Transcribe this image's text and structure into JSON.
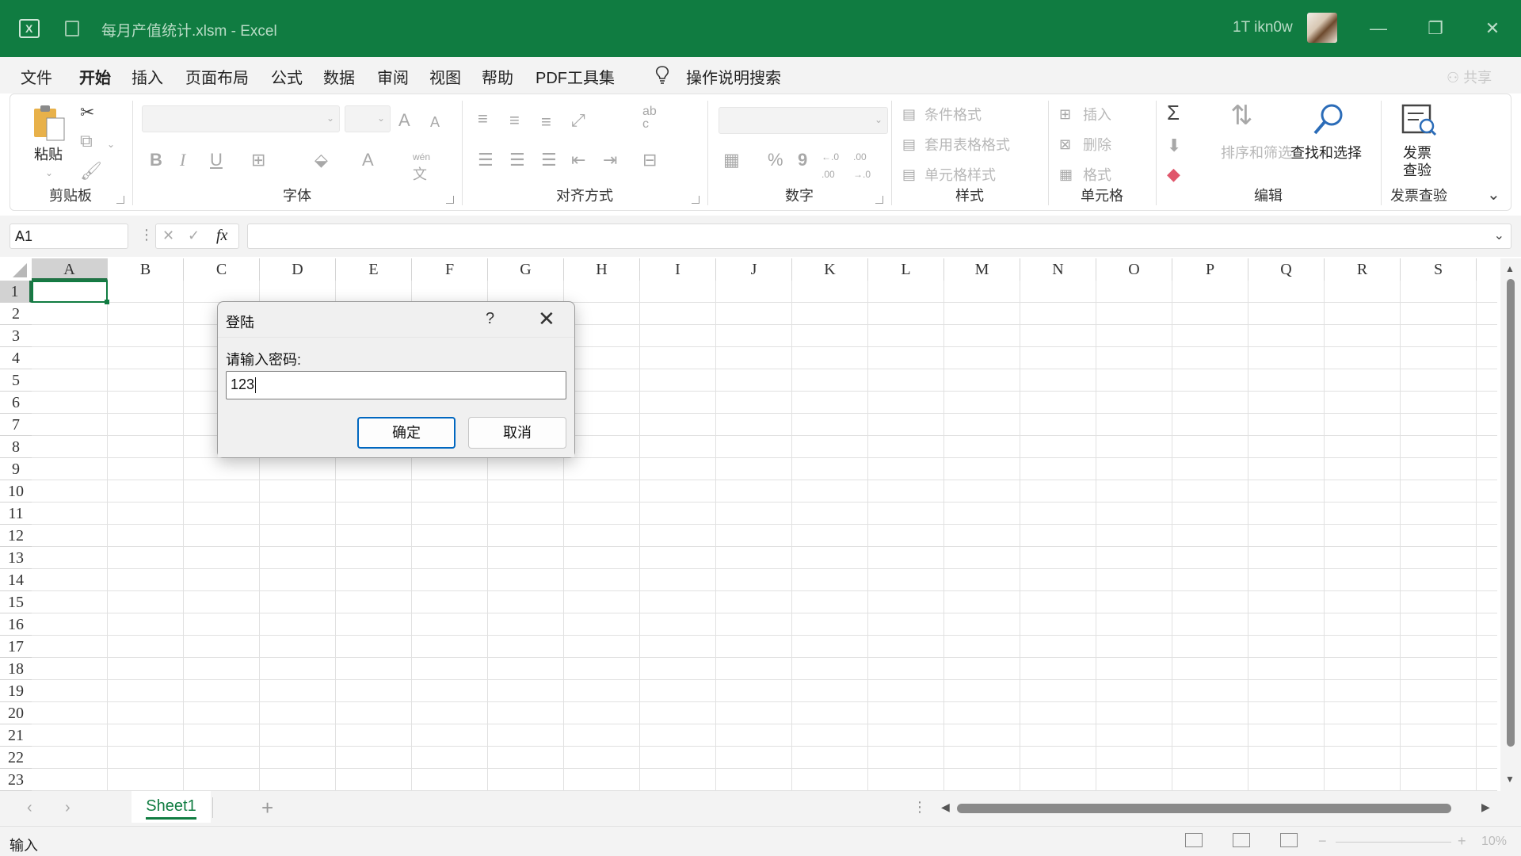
{
  "window": {
    "title": "每月产值统计.xlsm  -  Excel",
    "user": "1T ikn0w",
    "controls": {
      "minimize": "—",
      "restore": "❐",
      "close": "✕"
    }
  },
  "menu": {
    "tabs": [
      "文件",
      "开始",
      "插入",
      "页面布局",
      "公式",
      "数据",
      "审阅",
      "视图",
      "帮助",
      "PDF工具集"
    ],
    "active": "开始",
    "search": "操作说明搜索",
    "share": "共享"
  },
  "ribbon": {
    "clipboard": {
      "paste": "粘贴",
      "label": "剪贴板"
    },
    "font": {
      "label": "字体",
      "bold": "B",
      "italic": "I",
      "underline": "U",
      "grow": "A",
      "shrink": "A",
      "color": "A",
      "phonetic_top": "wén",
      "phonetic_bottom": "文"
    },
    "alignment": {
      "label": "对齐方式",
      "wrap_top": "ab",
      "wrap_bottom": "c"
    },
    "number": {
      "label": "数字",
      "percent": "%",
      "comma": "9",
      "inc": "←.0 .00",
      "dec": ".00 →.0"
    },
    "styles": {
      "label": "样式",
      "conditional": "条件格式",
      "table": "套用表格格式",
      "cell_styles": "单元格样式"
    },
    "cells": {
      "label": "单元格",
      "insert": "插入",
      "delete": "删除",
      "format": "格式"
    },
    "editing": {
      "label": "编辑",
      "sum": "Σ",
      "sort": "排序和筛选",
      "find": "查找和选择"
    },
    "invoice": {
      "label": "发票查验",
      "btn_line1": "发票",
      "btn_line2": "查验"
    }
  },
  "formula_bar": {
    "name_box": "A1",
    "fx": "fx",
    "cancel": "✕",
    "enter": "✓",
    "content": ""
  },
  "grid": {
    "columns": [
      "A",
      "B",
      "C",
      "D",
      "E",
      "F",
      "G",
      "H",
      "I",
      "J",
      "K",
      "L",
      "M",
      "N",
      "O",
      "P",
      "Q",
      "R",
      "S"
    ],
    "rows": [
      "1",
      "2",
      "3",
      "4",
      "5",
      "6",
      "7",
      "8",
      "9",
      "10",
      "11",
      "12",
      "13",
      "14",
      "15",
      "16",
      "17",
      "18",
      "19",
      "20",
      "21",
      "22",
      "23"
    ],
    "active_cell": "A1"
  },
  "dialog": {
    "title": "登陆",
    "help": "?",
    "close": "✕",
    "prompt": "请输入密码:",
    "value": "123",
    "ok": "确定",
    "cancel": "取消"
  },
  "sheets": {
    "tabs": [
      "Sheet1"
    ],
    "active": "Sheet1",
    "add": "+",
    "prev": "‹",
    "next": "›"
  },
  "status": {
    "mode": "输入",
    "zoom": "10%"
  },
  "colors": {
    "brand": "#107c41",
    "dialog_default_border": "#0067c0"
  }
}
